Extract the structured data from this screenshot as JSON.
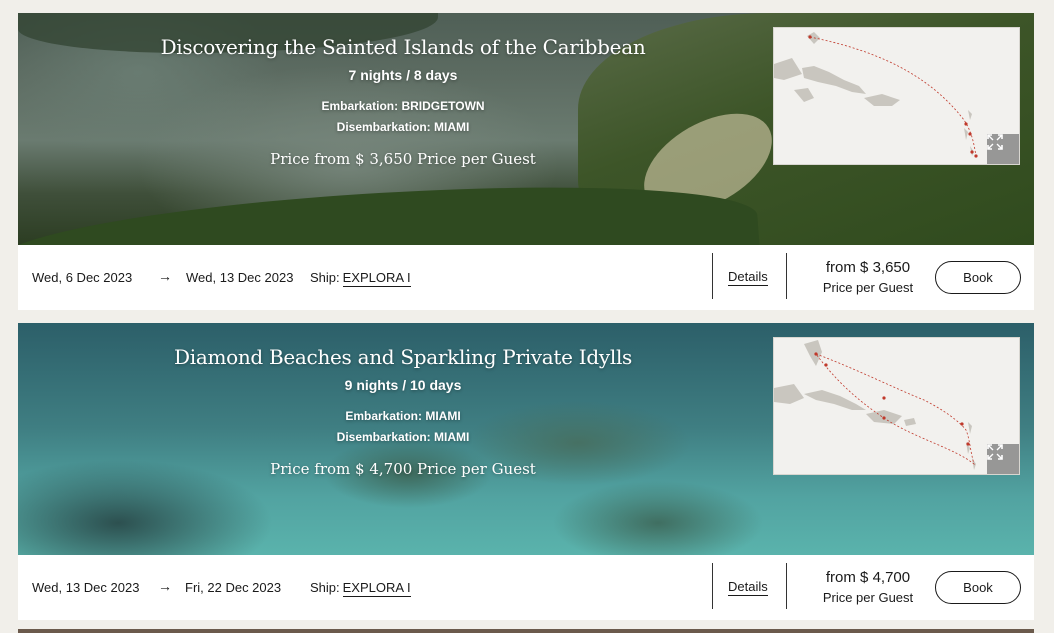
{
  "cruises": [
    {
      "title": "Discovering the Sainted Islands of the Caribbean",
      "duration": "7 nights / 8 days",
      "embarkation": "Embarkation: BRIDGETOWN",
      "disembarkation": "Disembarkation: MIAMI",
      "price_line": "Price from $ 3,650 Price per Guest",
      "start_date": "Wed, 6 Dec 2023",
      "arrow": "→",
      "end_date": "Wed, 13 Dec 2023",
      "ship_label": "Ship:",
      "ship_name": "EXPLORA I",
      "details_label": "Details",
      "price_from": "from $ 3,650",
      "price_per": "Price per Guest",
      "book_label": "Book",
      "map_icon": "expand-icon"
    },
    {
      "title": "Diamond Beaches and Sparkling Private Idylls",
      "duration": "9 nights / 10 days",
      "embarkation": "Embarkation: MIAMI",
      "disembarkation": "Disembarkation: MIAMI",
      "price_line": "Price from $ 4,700 Price per Guest",
      "start_date": "Wed, 13 Dec 2023",
      "arrow": "→",
      "end_date": "Fri, 22 Dec 2023",
      "ship_label": "Ship:",
      "ship_name": "EXPLORA I",
      "details_label": "Details",
      "price_from": "from $ 4,700",
      "price_per": "Price per Guest",
      "book_label": "Book",
      "map_icon": "expand-icon"
    }
  ],
  "colors": {
    "page_bg": "#f1efea",
    "route": "#c0392b"
  }
}
